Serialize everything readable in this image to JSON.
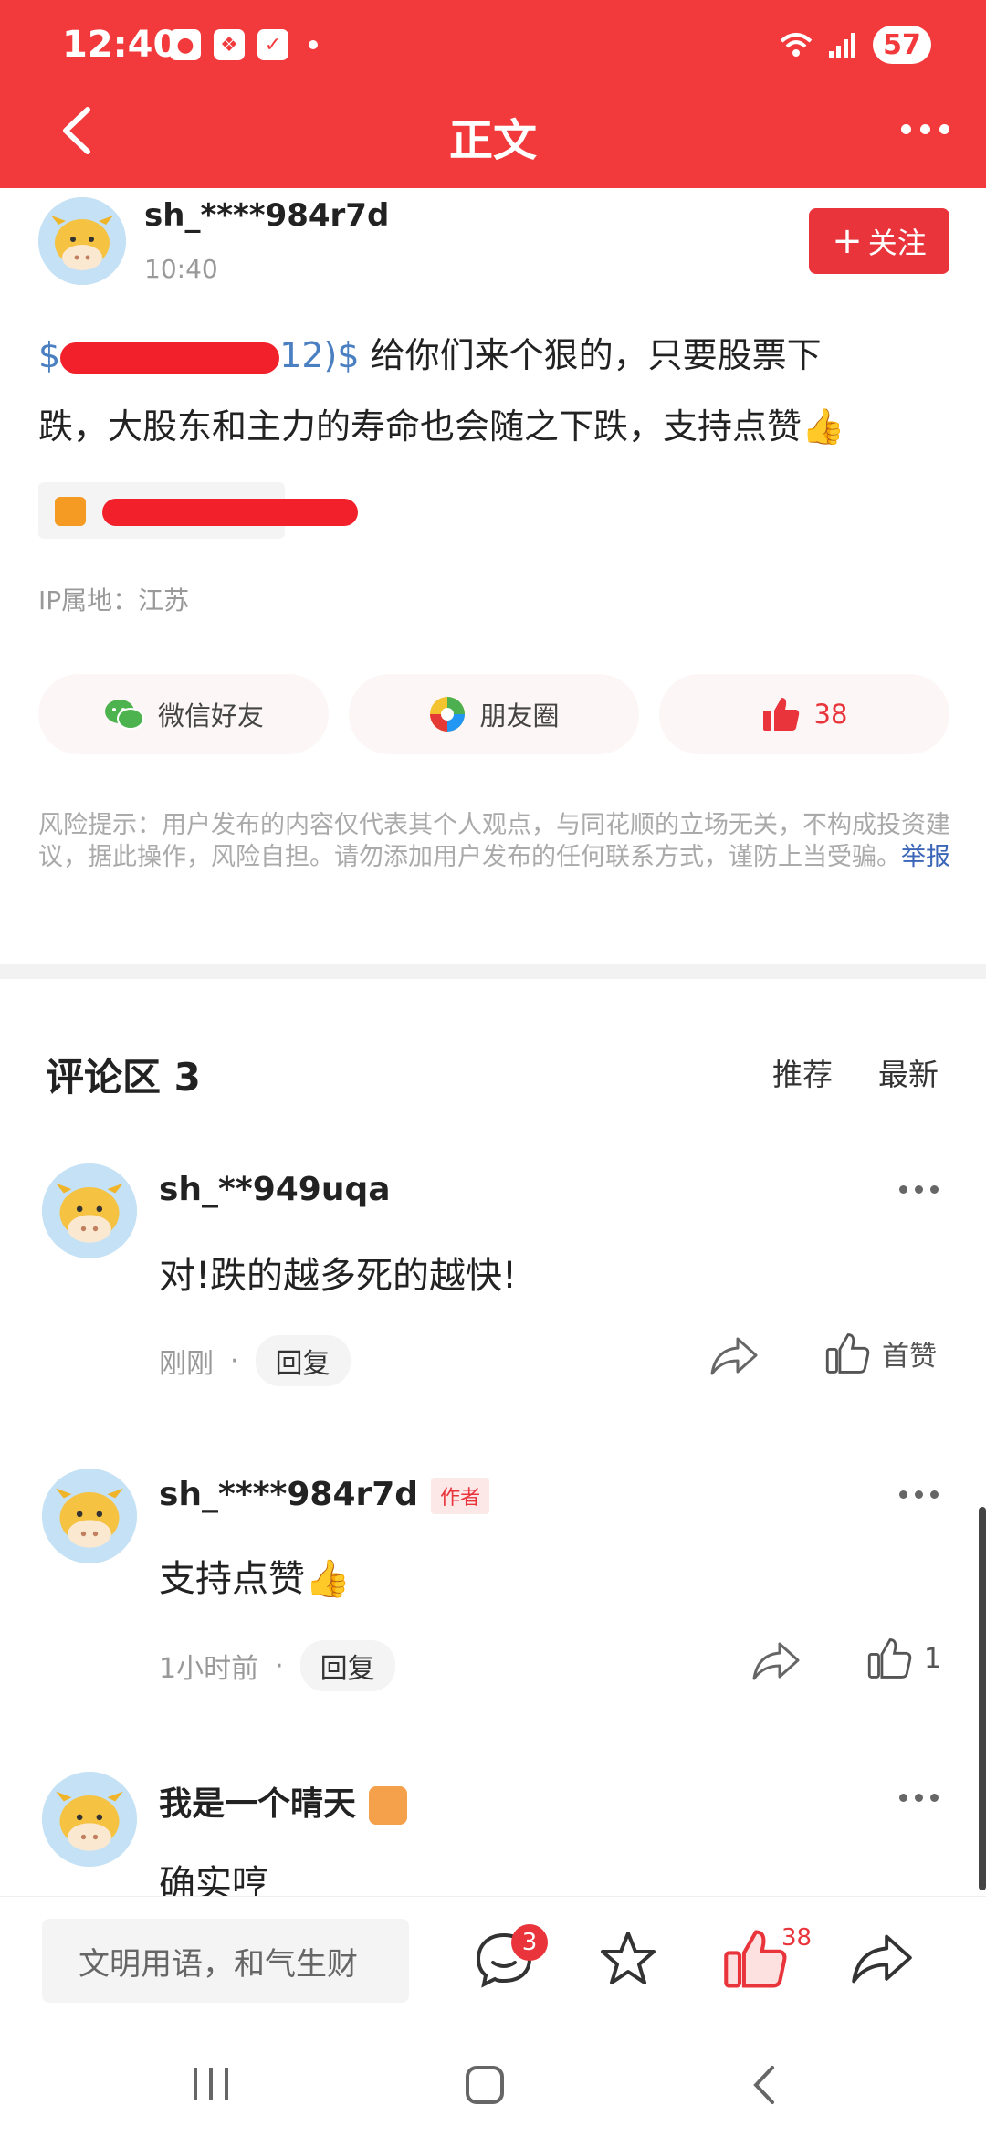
{
  "status": {
    "time": "12:40",
    "battery": "57"
  },
  "header": {
    "title": "正文"
  },
  "post": {
    "author": "sh_****984r7d",
    "time": "10:40",
    "follow_label": "关注",
    "stock_tag_visible": "$",
    "stock_tag_visible2": "12)$",
    "text_line1": " 给你们来个狠的，只要股票下",
    "text_line2": "跌，大股东和主力的寿命也会随之下跌，支持点赞👍",
    "ip_location": "IP属地：江苏",
    "share": {
      "wechat": "微信好友",
      "moments": "朋友圈",
      "likes": "38"
    },
    "risk_notice": "风险提示：用户发布的内容仅代表其个人观点，与同花顺的立场无关，不构成投资建议，据此操作，风险自担。请勿添加用户发布的任何联系方式，谨防上当受骗。",
    "report_label": "举报"
  },
  "comments": {
    "title": "评论区 3",
    "sort_options": [
      "推荐",
      "最新"
    ],
    "items": [
      {
        "name": "sh_**949uqa",
        "text": "对!跌的越多死的越快!",
        "time": "刚刚",
        "reply": "回复",
        "likes": "首赞"
      },
      {
        "name": "sh_****984r7d",
        "badge": "作者",
        "text": "支持点赞👍",
        "time": "1小时前",
        "reply": "回复",
        "likes": "1"
      },
      {
        "name": "我是一个晴天",
        "text": "确实哼"
      }
    ]
  },
  "bottom_bar": {
    "input_placeholder": "文明用语，和气生财",
    "comment_count": "3",
    "like_count": "38"
  },
  "colors": {
    "brand_red": "#f23a3c",
    "link_blue": "#4a7fc1"
  }
}
